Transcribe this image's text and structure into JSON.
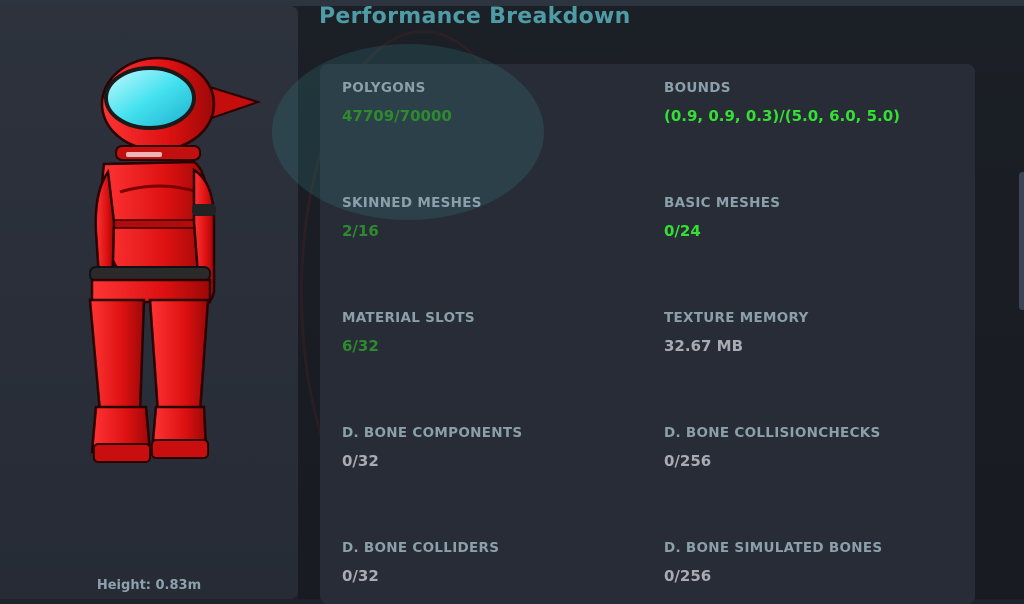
{
  "title": "Performance Breakdown",
  "avatar": {
    "height_label": "Height: 0.83m"
  },
  "stats": [
    {
      "label": "POLYGONS",
      "value": "47709/70000",
      "color": "#2e8a2e"
    },
    {
      "label": "BOUNDS",
      "value": "(0.9, 0.9, 0.3)/(5.0, 6.0, 5.0)",
      "color": "#33e033"
    },
    {
      "label": "SKINNED MESHES",
      "value": "2/16",
      "color": "#2e8a2e"
    },
    {
      "label": "BASIC MESHES",
      "value": "0/24",
      "color": "#33e033"
    },
    {
      "label": "MATERIAL SLOTS",
      "value": "6/32",
      "color": "#2e8a2e"
    },
    {
      "label": "TEXTURE MEMORY",
      "value": "32.67 MB",
      "color": "#a8acb2"
    },
    {
      "label": "D. BONE COMPONENTS",
      "value": "0/32",
      "color": "#a8acb2"
    },
    {
      "label": "D. BONE COLLISIONCHECKS",
      "value": "0/256",
      "color": "#a8acb2"
    },
    {
      "label": "D. BONE COLLIDERS",
      "value": "0/32",
      "color": "#a8acb2"
    },
    {
      "label": "D. BONE SIMULATED BONES",
      "value": "0/256",
      "color": "#a8acb2"
    }
  ],
  "colors": {
    "title": "#4f9ca6",
    "label": "#8aa0aa",
    "good": "#2e8a2e",
    "excellent": "#33e033",
    "neutral": "#a8acb2",
    "avatar": "#e01515"
  }
}
